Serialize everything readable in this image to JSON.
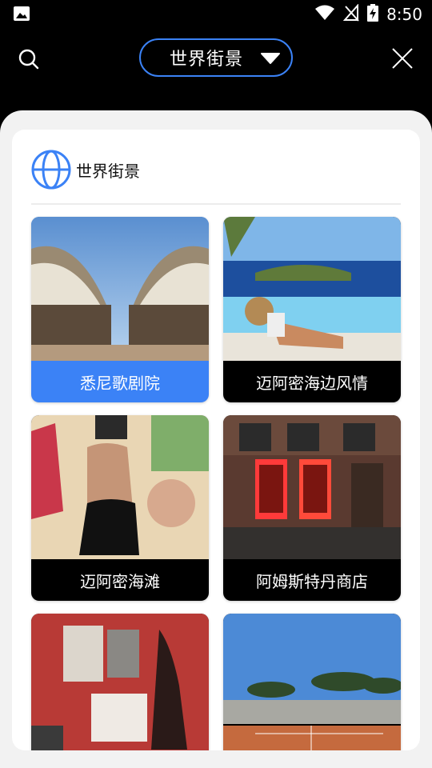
{
  "status_bar": {
    "time": "8:50"
  },
  "header": {
    "dropdown_label": "世界街景"
  },
  "section": {
    "title": "世界街景"
  },
  "tiles": [
    {
      "label": "悉尼歌剧院",
      "selected": true
    },
    {
      "label": "迈阿密海边风情",
      "selected": false
    },
    {
      "label": "迈阿密海滩",
      "selected": false
    },
    {
      "label": "阿姆斯特丹商店",
      "selected": false
    },
    {
      "label": "",
      "selected": false
    },
    {
      "label": "",
      "selected": false
    }
  ],
  "colors": {
    "accent": "#3b82f6",
    "background": "#000000",
    "sheet": "#f2f2f2"
  }
}
